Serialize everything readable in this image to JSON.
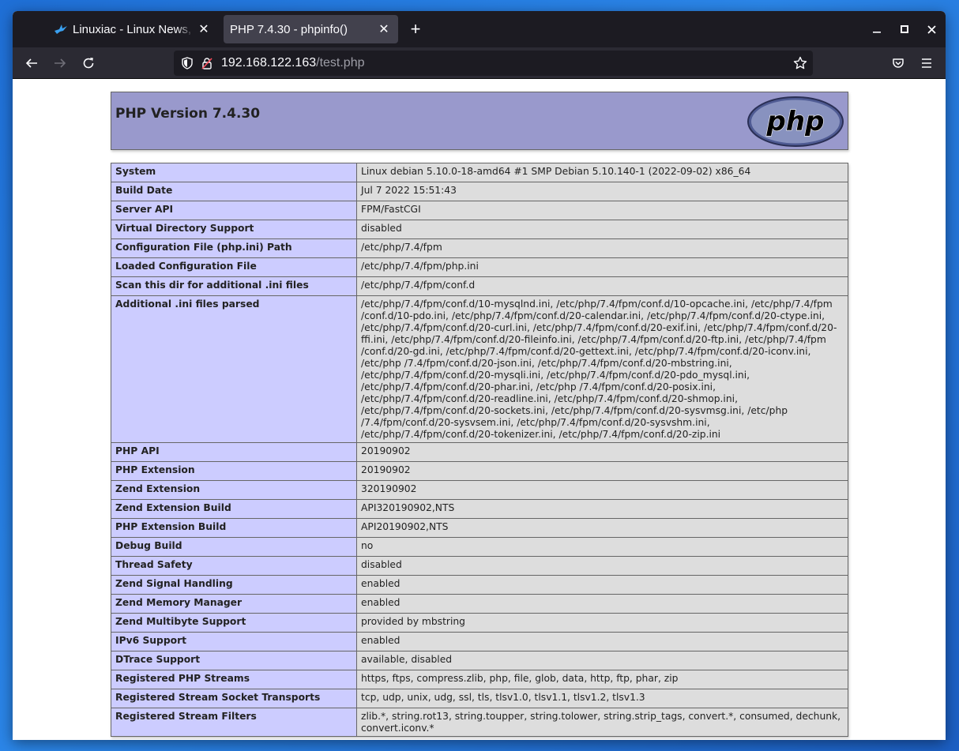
{
  "browser": {
    "tabs": [
      {
        "title": "Linuxiac - Linux News,",
        "active": false
      },
      {
        "title": "PHP 7.4.30 - phpinfo()",
        "active": true
      }
    ],
    "url_host": "192.168.122.163",
    "url_path": "/test.php"
  },
  "page": {
    "heading": "PHP Version 7.4.30",
    "logo_text": "php",
    "rows": [
      {
        "key": "System",
        "value": "Linux debian 5.10.0-18-amd64 #1 SMP Debian 5.10.140-1 (2022-09-02) x86_64"
      },
      {
        "key": "Build Date",
        "value": "Jul 7 2022 15:51:43"
      },
      {
        "key": "Server API",
        "value": "FPM/FastCGI"
      },
      {
        "key": "Virtual Directory Support",
        "value": "disabled"
      },
      {
        "key": "Configuration File (php.ini) Path",
        "value": "/etc/php/7.4/fpm"
      },
      {
        "key": "Loaded Configuration File",
        "value": "/etc/php/7.4/fpm/php.ini"
      },
      {
        "key": "Scan this dir for additional .ini files",
        "value": "/etc/php/7.4/fpm/conf.d"
      },
      {
        "key": "Additional .ini files parsed",
        "value": "/etc/php/7.4/fpm/conf.d/10-mysqlnd.ini, /etc/php/7.4/fpm/conf.d/10-opcache.ini, /etc/php/7.4/fpm /conf.d/10-pdo.ini, /etc/php/7.4/fpm/conf.d/20-calendar.ini, /etc/php/7.4/fpm/conf.d/20-ctype.ini, /etc/php/7.4/fpm/conf.d/20-curl.ini, /etc/php/7.4/fpm/conf.d/20-exif.ini, /etc/php/7.4/fpm/conf.d/20-ffi.ini, /etc/php/7.4/fpm/conf.d/20-fileinfo.ini, /etc/php/7.4/fpm/conf.d/20-ftp.ini, /etc/php/7.4/fpm /conf.d/20-gd.ini, /etc/php/7.4/fpm/conf.d/20-gettext.ini, /etc/php/7.4/fpm/conf.d/20-iconv.ini, /etc/php /7.4/fpm/conf.d/20-json.ini, /etc/php/7.4/fpm/conf.d/20-mbstring.ini, /etc/php/7.4/fpm/conf.d/20-mysqli.ini, /etc/php/7.4/fpm/conf.d/20-pdo_mysql.ini, /etc/php/7.4/fpm/conf.d/20-phar.ini, /etc/php /7.4/fpm/conf.d/20-posix.ini, /etc/php/7.4/fpm/conf.d/20-readline.ini, /etc/php/7.4/fpm/conf.d/20-shmop.ini, /etc/php/7.4/fpm/conf.d/20-sockets.ini, /etc/php/7.4/fpm/conf.d/20-sysvmsg.ini, /etc/php /7.4/fpm/conf.d/20-sysvsem.ini, /etc/php/7.4/fpm/conf.d/20-sysvshm.ini, /etc/php/7.4/fpm/conf.d/20-tokenizer.ini, /etc/php/7.4/fpm/conf.d/20-zip.ini"
      },
      {
        "key": "PHP API",
        "value": "20190902"
      },
      {
        "key": "PHP Extension",
        "value": "20190902"
      },
      {
        "key": "Zend Extension",
        "value": "320190902"
      },
      {
        "key": "Zend Extension Build",
        "value": "API320190902,NTS"
      },
      {
        "key": "PHP Extension Build",
        "value": "API20190902,NTS"
      },
      {
        "key": "Debug Build",
        "value": "no"
      },
      {
        "key": "Thread Safety",
        "value": "disabled"
      },
      {
        "key": "Zend Signal Handling",
        "value": "enabled"
      },
      {
        "key": "Zend Memory Manager",
        "value": "enabled"
      },
      {
        "key": "Zend Multibyte Support",
        "value": "provided by mbstring"
      },
      {
        "key": "IPv6 Support",
        "value": "enabled"
      },
      {
        "key": "DTrace Support",
        "value": "available, disabled"
      },
      {
        "key": "Registered PHP Streams",
        "value": "https, ftps, compress.zlib, php, file, glob, data, http, ftp, phar, zip"
      },
      {
        "key": "Registered Stream Socket Transports",
        "value": "tcp, udp, unix, udg, ssl, tls, tlsv1.0, tlsv1.1, tlsv1.2, tlsv1.3"
      },
      {
        "key": "Registered Stream Filters",
        "value": "zlib.*, string.rot13, string.toupper, string.tolower, string.strip_tags, convert.*, consumed, dechunk, convert.iconv.*"
      }
    ]
  },
  "colors": {
    "header_bg": "#9999cc",
    "key_bg": "#ccccff",
    "value_bg": "#dddddd",
    "tabbar_bg": "#1c1b22",
    "navbar_bg": "#2b2a33",
    "desktop_bg": "#2b86e8"
  },
  "icons": {
    "tab1_favicon": "linuxiac-bird-icon",
    "tab_close": "close-icon",
    "new_tab": "plus-icon",
    "back": "arrow-left-icon",
    "forward": "arrow-right-icon",
    "reload": "reload-icon",
    "tracking_protection": "shield-icon",
    "insecure": "lock-slash-icon",
    "bookmark": "star-icon",
    "pocket": "pocket-icon",
    "menu": "hamburger-menu-icon"
  }
}
